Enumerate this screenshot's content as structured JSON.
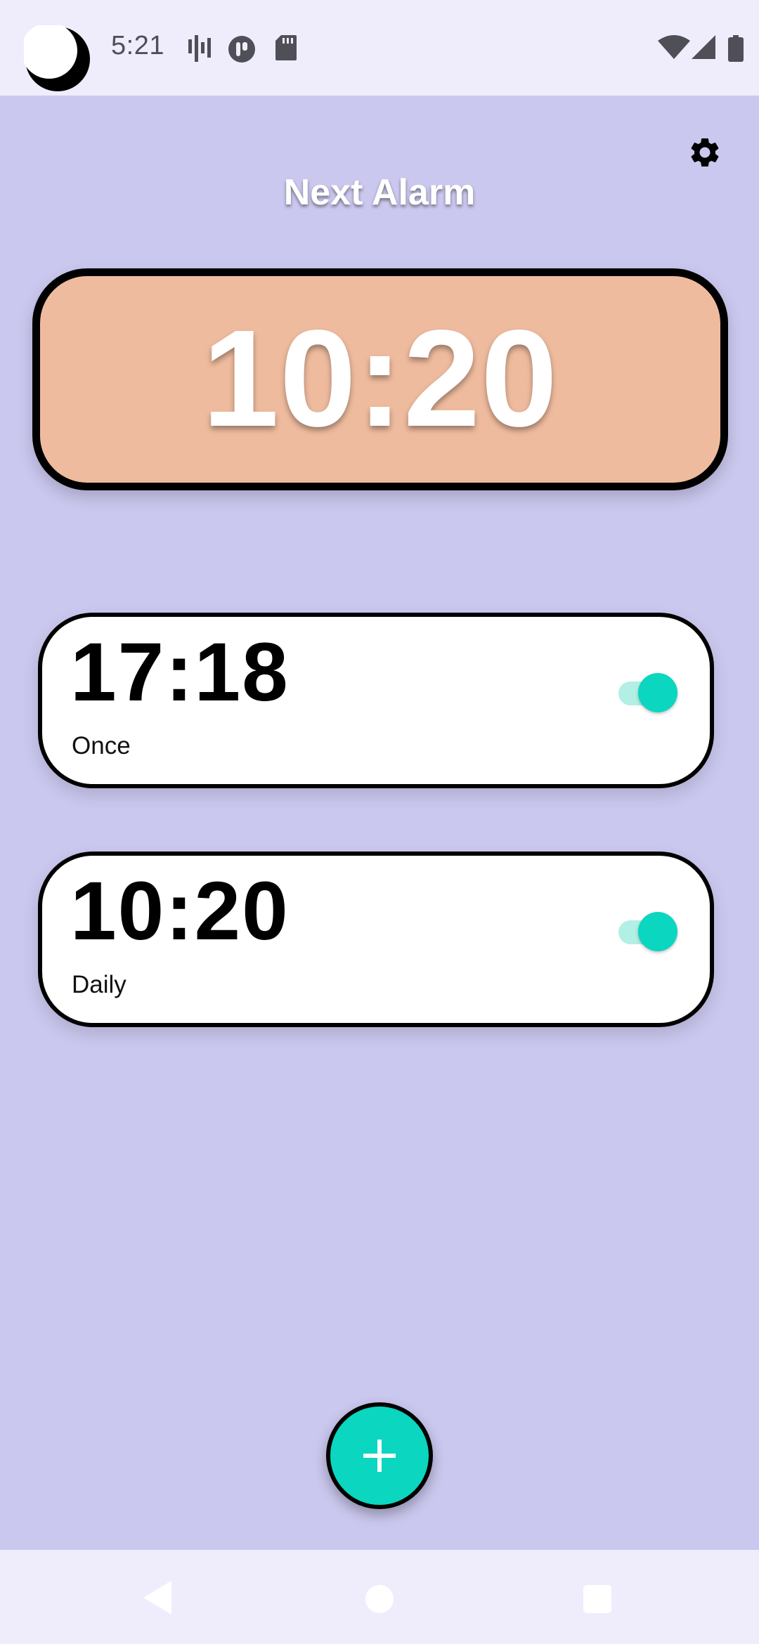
{
  "status_bar": {
    "time": "5:21",
    "left_icons": [
      "moon-icon",
      "signal-activity-icon",
      "app-notification-icon",
      "sd-card-icon"
    ],
    "right_icons": [
      "wifi-icon",
      "cell-signal-icon",
      "battery-icon"
    ]
  },
  "header": {
    "title": "Next Alarm",
    "settings_icon": "gear-icon"
  },
  "next_alarm": {
    "time": "10:20",
    "card_color": "#efbb9e"
  },
  "alarms": [
    {
      "time": "17:18",
      "repeat": "Once",
      "enabled": true
    },
    {
      "time": "10:20",
      "repeat": "Daily",
      "enabled": true
    }
  ],
  "fab": {
    "icon": "plus-icon",
    "color": "#0bd6bf"
  },
  "nav_bar": {
    "buttons": [
      "back-icon",
      "home-icon",
      "recents-icon"
    ]
  },
  "colors": {
    "background": "#cbc8ef",
    "system_bars": "#efedfc",
    "accent": "#0bd6bf",
    "toggle_track": "#b2efe4"
  }
}
